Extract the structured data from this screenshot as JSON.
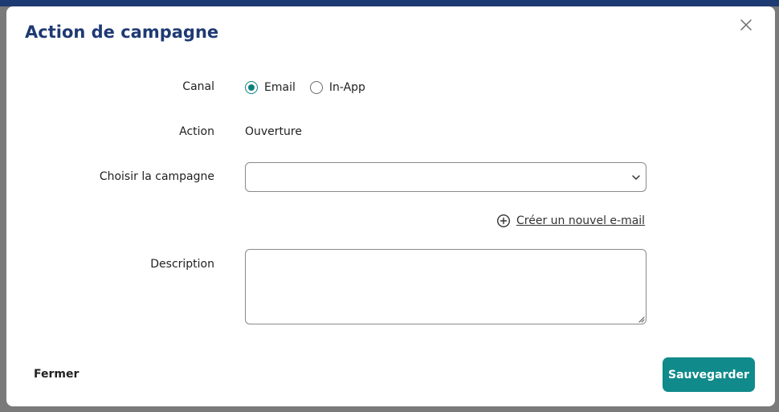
{
  "modal": {
    "title": "Action de campagne",
    "close_icon": "close-icon"
  },
  "form": {
    "canal": {
      "label": "Canal",
      "options": [
        {
          "label": "Email",
          "checked": true
        },
        {
          "label": "In-App",
          "checked": false
        }
      ]
    },
    "action": {
      "label": "Action",
      "value": "Ouverture"
    },
    "campagne": {
      "label": "Choisir la campagne",
      "value": ""
    },
    "create_link": {
      "label": "Créer un nouvel e-mail",
      "icon": "plus-circle-icon"
    },
    "description": {
      "label": "Description",
      "value": ""
    }
  },
  "footer": {
    "close_label": "Fermer",
    "save_label": "Sauvegarder"
  },
  "colors": {
    "accent": "#108a8a",
    "title": "#1e3a72"
  }
}
